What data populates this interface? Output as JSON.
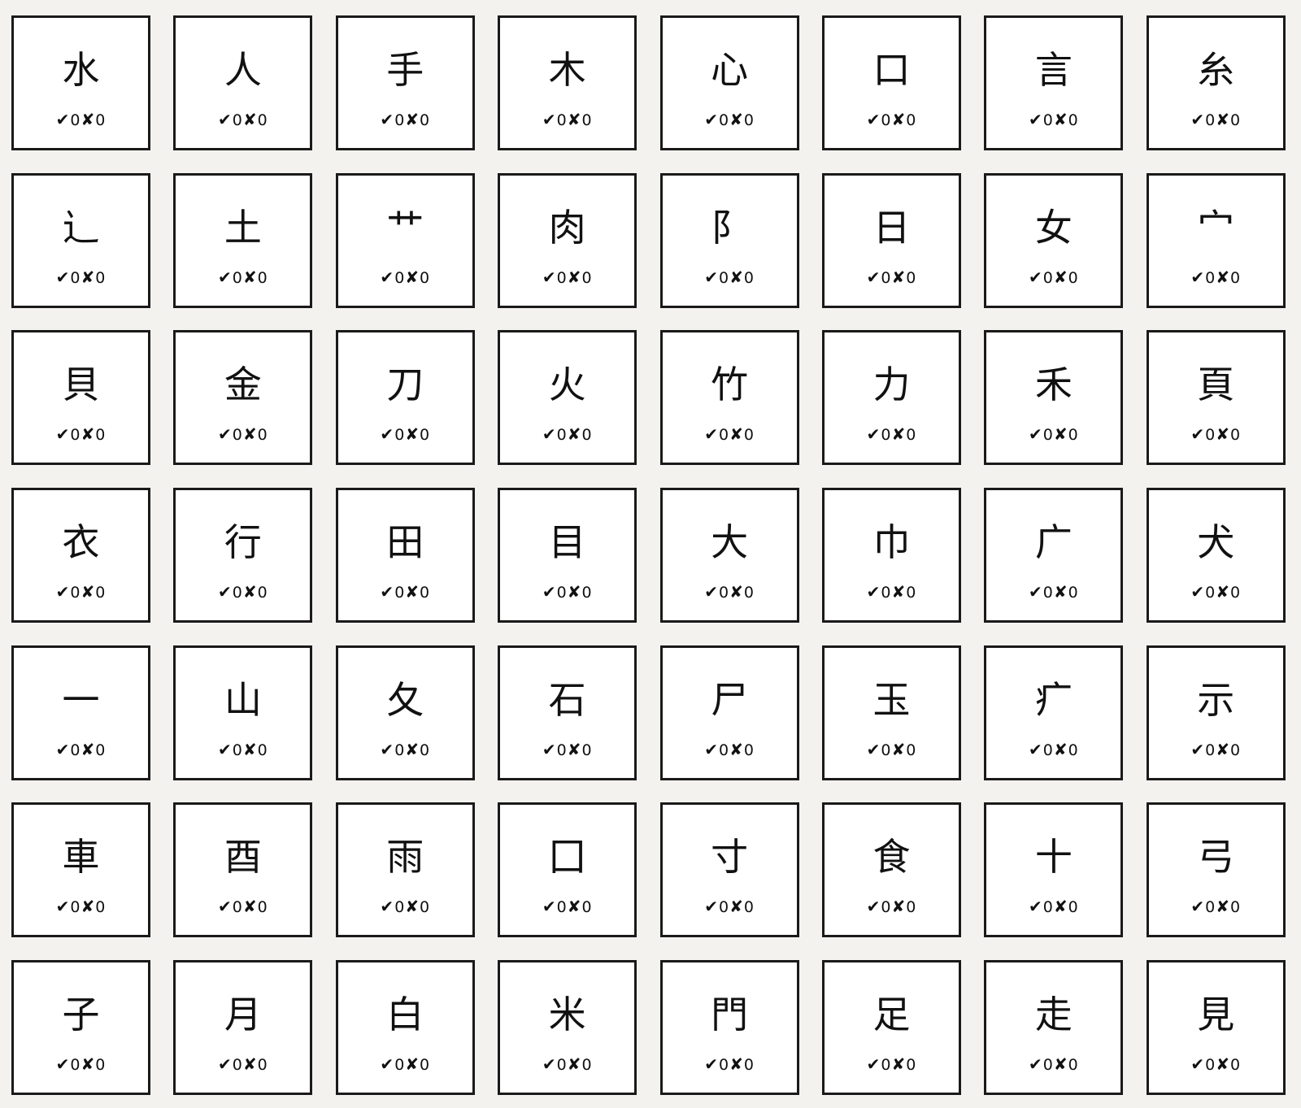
{
  "cards": [
    {
      "char": "水",
      "correct": "0",
      "wrong": "0"
    },
    {
      "char": "人",
      "correct": "0",
      "wrong": "0"
    },
    {
      "char": "手",
      "correct": "0",
      "wrong": "0"
    },
    {
      "char": "木",
      "correct": "0",
      "wrong": "0"
    },
    {
      "char": "心",
      "correct": "0",
      "wrong": "0"
    },
    {
      "char": "口",
      "correct": "0",
      "wrong": "0"
    },
    {
      "char": "言",
      "correct": "0",
      "wrong": "0"
    },
    {
      "char": "糸",
      "correct": "0",
      "wrong": "0"
    },
    {
      "char": "辶",
      "correct": "0",
      "wrong": "0"
    },
    {
      "char": "土",
      "correct": "0",
      "wrong": "0"
    },
    {
      "char": "艹",
      "correct": "0",
      "wrong": "0"
    },
    {
      "char": "肉",
      "correct": "0",
      "wrong": "0"
    },
    {
      "char": "阝",
      "correct": "0",
      "wrong": "0"
    },
    {
      "char": "日",
      "correct": "0",
      "wrong": "0"
    },
    {
      "char": "女",
      "correct": "0",
      "wrong": "0"
    },
    {
      "char": "宀",
      "correct": "0",
      "wrong": "0"
    },
    {
      "char": "貝",
      "correct": "0",
      "wrong": "0"
    },
    {
      "char": "金",
      "correct": "0",
      "wrong": "0"
    },
    {
      "char": "刀",
      "correct": "0",
      "wrong": "0"
    },
    {
      "char": "火",
      "correct": "0",
      "wrong": "0"
    },
    {
      "char": "竹",
      "correct": "0",
      "wrong": "0"
    },
    {
      "char": "力",
      "correct": "0",
      "wrong": "0"
    },
    {
      "char": "禾",
      "correct": "0",
      "wrong": "0"
    },
    {
      "char": "頁",
      "correct": "0",
      "wrong": "0"
    },
    {
      "char": "衣",
      "correct": "0",
      "wrong": "0"
    },
    {
      "char": "行",
      "correct": "0",
      "wrong": "0"
    },
    {
      "char": "田",
      "correct": "0",
      "wrong": "0"
    },
    {
      "char": "目",
      "correct": "0",
      "wrong": "0"
    },
    {
      "char": "大",
      "correct": "0",
      "wrong": "0"
    },
    {
      "char": "巾",
      "correct": "0",
      "wrong": "0"
    },
    {
      "char": "广",
      "correct": "0",
      "wrong": "0"
    },
    {
      "char": "犬",
      "correct": "0",
      "wrong": "0"
    },
    {
      "char": "一",
      "correct": "0",
      "wrong": "0"
    },
    {
      "char": "山",
      "correct": "0",
      "wrong": "0"
    },
    {
      "char": "夂",
      "correct": "0",
      "wrong": "0"
    },
    {
      "char": "石",
      "correct": "0",
      "wrong": "0"
    },
    {
      "char": "尸",
      "correct": "0",
      "wrong": "0"
    },
    {
      "char": "玉",
      "correct": "0",
      "wrong": "0"
    },
    {
      "char": "疒",
      "correct": "0",
      "wrong": "0"
    },
    {
      "char": "示",
      "correct": "0",
      "wrong": "0"
    },
    {
      "char": "車",
      "correct": "0",
      "wrong": "0"
    },
    {
      "char": "酉",
      "correct": "0",
      "wrong": "0"
    },
    {
      "char": "雨",
      "correct": "0",
      "wrong": "0"
    },
    {
      "char": "囗",
      "correct": "0",
      "wrong": "0"
    },
    {
      "char": "寸",
      "correct": "0",
      "wrong": "0"
    },
    {
      "char": "食",
      "correct": "0",
      "wrong": "0"
    },
    {
      "char": "十",
      "correct": "0",
      "wrong": "0"
    },
    {
      "char": "弓",
      "correct": "0",
      "wrong": "0"
    },
    {
      "char": "子",
      "correct": "0",
      "wrong": "0"
    },
    {
      "char": "月",
      "correct": "0",
      "wrong": "0"
    },
    {
      "char": "白",
      "correct": "0",
      "wrong": "0"
    },
    {
      "char": "米",
      "correct": "0",
      "wrong": "0"
    },
    {
      "char": "門",
      "correct": "0",
      "wrong": "0"
    },
    {
      "char": "足",
      "correct": "0",
      "wrong": "0"
    },
    {
      "char": "走",
      "correct": "0",
      "wrong": "0"
    },
    {
      "char": "見",
      "correct": "0",
      "wrong": "0"
    }
  ],
  "icons": {
    "correct": "✔",
    "wrong": "✘"
  }
}
